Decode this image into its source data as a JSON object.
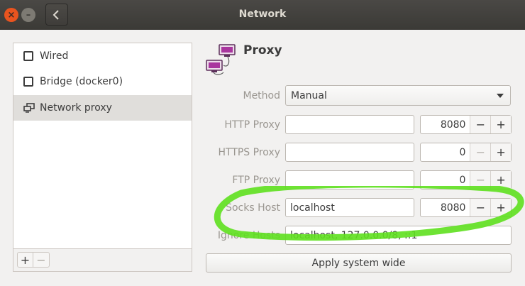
{
  "window": {
    "title": "Network",
    "close_glyph": "×",
    "min_glyph": "–"
  },
  "sidebar": {
    "items": [
      {
        "label": "Wired",
        "icon": "wired-icon"
      },
      {
        "label": "Bridge (docker0)",
        "icon": "bridge-icon"
      },
      {
        "label": "Network proxy",
        "icon": "network-proxy-icon"
      }
    ],
    "add_label": "+",
    "remove_label": "−"
  },
  "proxy": {
    "title": "Proxy",
    "method": {
      "label": "Method",
      "value": "Manual"
    },
    "http": {
      "label": "HTTP Proxy",
      "host": "",
      "port": "8080"
    },
    "https": {
      "label": "HTTPS Proxy",
      "host": "",
      "port": "0"
    },
    "ftp": {
      "label": "FTP Proxy",
      "host": "",
      "port": "0"
    },
    "socks": {
      "label": "Socks Host",
      "host": "localhost",
      "port": "8080"
    },
    "ignore": {
      "label": "Ignore Hosts",
      "value": "localhost, 127.0.0.0/8, ::1"
    },
    "minus": "−",
    "plus": "+",
    "apply_label": "Apply system wide"
  },
  "colors": {
    "highlight": "#5ee01e",
    "titlebar": "#3b3a36",
    "close": "#e9541f"
  }
}
